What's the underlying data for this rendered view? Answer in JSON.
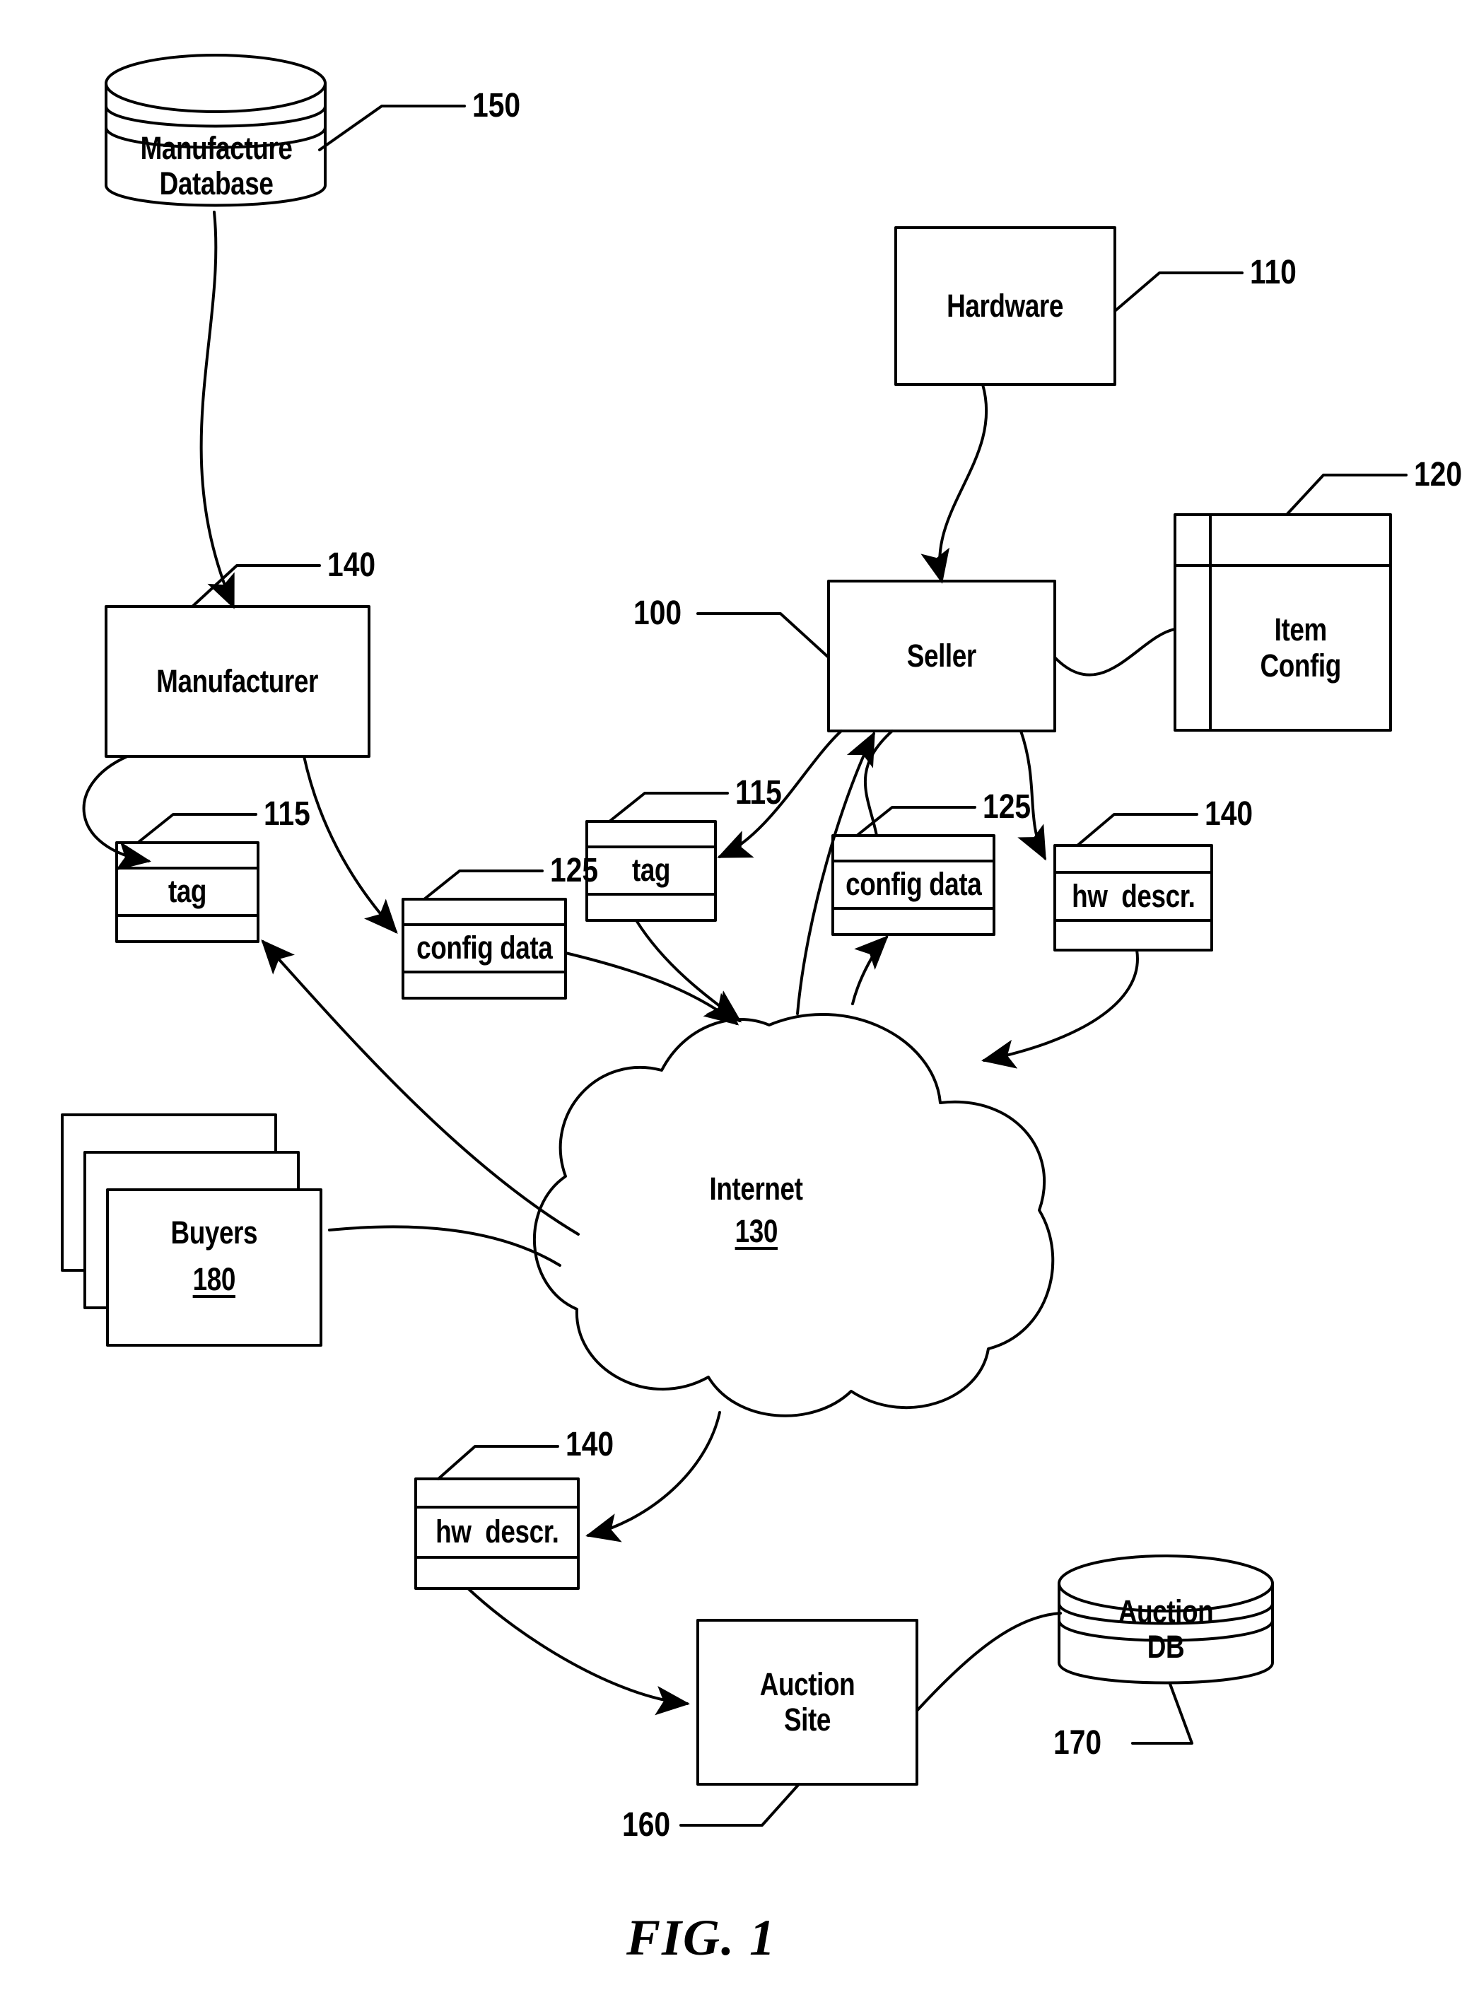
{
  "figure": {
    "caption": "FIG. 1"
  },
  "nodes": {
    "manufacture_database": {
      "label": "Manufacture\nDatabase",
      "ref": "150"
    },
    "manufacturer": {
      "label": "Manufacturer",
      "ref": "140"
    },
    "tag_left": {
      "label": "tag",
      "ref": "115"
    },
    "config_data_left": {
      "label": "config data",
      "ref": "125"
    },
    "tag_mid": {
      "label": "tag",
      "ref": "115"
    },
    "seller": {
      "label": "Seller",
      "ref": "100"
    },
    "hardware": {
      "label": "Hardware",
      "ref": "110"
    },
    "item_config": {
      "label": "Item\nConfig",
      "ref": "120"
    },
    "config_data_right": {
      "label": "config data",
      "ref": "125"
    },
    "hw_descr_right": {
      "label": "hw  descr.",
      "ref": "140"
    },
    "internet": {
      "label": "Internet",
      "ref": "130"
    },
    "buyers": {
      "label": "Buyers",
      "ref": "180"
    },
    "hw_descr_bottom": {
      "label": "hw  descr.",
      "ref": "140"
    },
    "auction_site": {
      "label": "Auction\nSite",
      "ref": "160"
    },
    "auction_db": {
      "label": "Auction\nDB",
      "ref": "170"
    }
  },
  "style": {
    "ink": "#000000",
    "paper": "#ffffff",
    "stroke_width": 4
  }
}
